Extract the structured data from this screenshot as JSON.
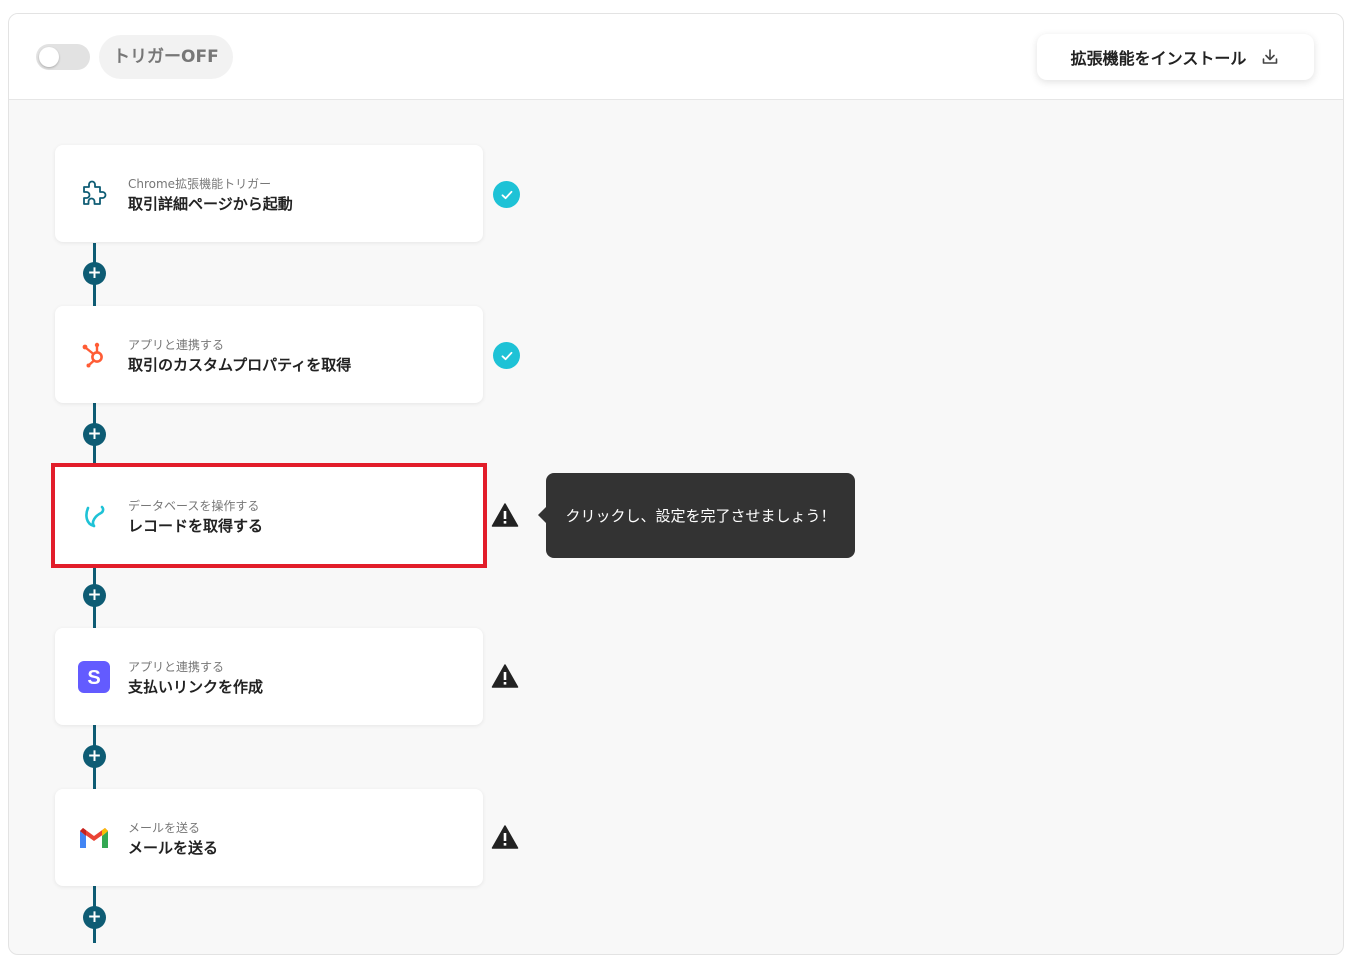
{
  "header": {
    "trigger_label": "トリガーOFF",
    "trigger_on": false,
    "install_label": "拡張機能をインストール"
  },
  "steps": [
    {
      "subtitle": "Chrome拡張機能トリガー",
      "title": "取引詳細ページから起動",
      "icon": "puzzle-icon",
      "status": "done"
    },
    {
      "subtitle": "アプリと連携する",
      "title": "取引のカスタムプロパティを取得",
      "icon": "hubspot-icon",
      "status": "done"
    },
    {
      "subtitle": "データベースを操作する",
      "title": "レコードを取得する",
      "icon": "yoom-database-icon",
      "status": "warning",
      "selected": true
    },
    {
      "subtitle": "アプリと連携する",
      "title": "支払いリンクを作成",
      "icon": "stripe-icon",
      "status": "warning"
    },
    {
      "subtitle": "メールを送る",
      "title": "メールを送る",
      "icon": "gmail-icon",
      "status": "warning"
    }
  ],
  "tooltip": {
    "text": "クリックし、設定を完了させましょう！"
  },
  "colors": {
    "accent": "#0e5c74",
    "ok": "#1ec2d6",
    "selected": "#e21d2a"
  }
}
